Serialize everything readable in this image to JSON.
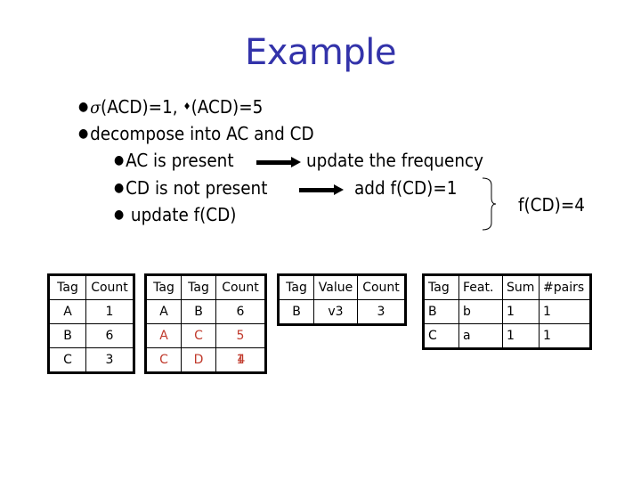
{
  "title": "Example",
  "bullets": {
    "line1": {
      "sym1": "σ",
      "text1": "(ACD)=1, ",
      "sym2": "♦",
      "text2": "(ACD)=5"
    },
    "line2": "decompose into AC and CD",
    "line3_left": "AC is present",
    "line3_right": "update the  frequency",
    "line4_left": "CD is not present",
    "line4_right": "add f(CD)=1",
    "line5": " update f(CD)",
    "result": "f(CD)=4"
  },
  "tables": {
    "t1": {
      "headers": [
        "Tag",
        "Count"
      ],
      "rows": [
        [
          "A",
          "1"
        ],
        [
          "B",
          "6"
        ],
        [
          "C",
          "3"
        ]
      ]
    },
    "t2": {
      "headers": [
        "Tag",
        "Tag",
        "Count"
      ],
      "rows": [
        [
          "A",
          "B",
          "6"
        ],
        [
          "A",
          "C",
          "5"
        ],
        [
          "C",
          "D",
          "4"
        ]
      ],
      "overlap_under": "1",
      "highlight_color": "#c0392b"
    },
    "t3": {
      "headers": [
        "Tag",
        "Value",
        "Count"
      ],
      "rows": [
        [
          "B",
          "v3",
          "3"
        ]
      ]
    },
    "t4": {
      "headers": [
        "Tag",
        "Feat.",
        "Sum",
        "#pairs"
      ],
      "rows": [
        [
          "B",
          "b",
          "1",
          "1"
        ],
        [
          "C",
          "a",
          "1",
          "1"
        ]
      ]
    }
  },
  "colors": {
    "title": "#3333aa",
    "highlight": "#c0392b"
  }
}
